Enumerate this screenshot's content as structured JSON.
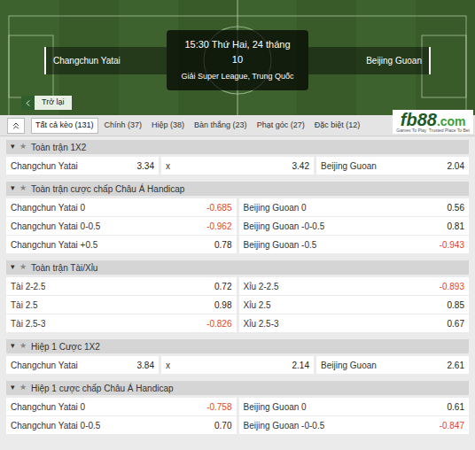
{
  "match": {
    "home": "Changchun Yatai",
    "away": "Beijing Guoan",
    "time": "15:30 Thứ Hai, 24 tháng 10",
    "league": "Giải Super League, Trung Quốc"
  },
  "back_button": {
    "label": "Trở lại"
  },
  "tabs": [
    {
      "label": "Tất cả kèo (131)",
      "selected": true
    },
    {
      "label": "Chính (37)",
      "selected": false
    },
    {
      "label": "Hiệp (38)",
      "selected": false
    },
    {
      "label": "Bàn thắng (23)",
      "selected": false
    },
    {
      "label": "Phạt góc (27)",
      "selected": false
    },
    {
      "label": "Đặc biệt (12)",
      "selected": false
    }
  ],
  "logo": {
    "name": "fb88",
    "suffix": ".com",
    "tagline": "Games To Play  Trusted Place To Bet"
  },
  "section_icons": {
    "toggle": "▾",
    "star": "★"
  },
  "sections": [
    {
      "title": "Toàn trận 1X2",
      "expanded": true,
      "rows": [
        {
          "cells": [
            {
              "label": "Changchun Yatai",
              "odds": "3.34",
              "negative": false
            },
            {
              "label": "x",
              "odds": "3.42",
              "negative": false
            },
            {
              "label": "Beijing Guoan",
              "odds": "2.04",
              "negative": false
            }
          ]
        }
      ]
    },
    {
      "title": "Toàn trận cược chấp Châu Á Handicap",
      "expanded": true,
      "rows": [
        {
          "cells": [
            {
              "label": "Changchun Yatai 0",
              "odds": "-0.685",
              "negative": true
            },
            {
              "label": "Beijing Guoan 0",
              "odds": "0.56",
              "negative": false
            }
          ]
        },
        {
          "cells": [
            {
              "label": "Changchun Yatai 0-0.5",
              "odds": "-0.962",
              "negative": true
            },
            {
              "label": "Beijing Guoan -0-0.5",
              "odds": "0.81",
              "negative": false
            }
          ]
        },
        {
          "cells": [
            {
              "label": "Changchun Yatai +0.5",
              "odds": "0.78",
              "negative": false
            },
            {
              "label": "Beijing Guoan -0.5",
              "odds": "-0.943",
              "negative": true
            }
          ]
        }
      ]
    },
    {
      "title": "Toàn trận Tài/Xỉu",
      "expanded": true,
      "rows": [
        {
          "cells": [
            {
              "label": "Tài 2-2.5",
              "odds": "0.72",
              "negative": false
            },
            {
              "label": "Xỉu 2-2.5",
              "odds": "-0.893",
              "negative": true
            }
          ]
        },
        {
          "cells": [
            {
              "label": "Tài 2.5",
              "odds": "0.98",
              "negative": false
            },
            {
              "label": "Xỉu 2.5",
              "odds": "0.85",
              "negative": false
            }
          ]
        },
        {
          "cells": [
            {
              "label": "Tài 2.5-3",
              "odds": "-0.826",
              "negative": true
            },
            {
              "label": "Xỉu 2.5-3",
              "odds": "0.67",
              "negative": false
            }
          ]
        }
      ]
    },
    {
      "title": "Hiệp 1 Cược 1X2",
      "expanded": true,
      "rows": [
        {
          "cells": [
            {
              "label": "Changchun Yatai",
              "odds": "3.84",
              "negative": false
            },
            {
              "label": "x",
              "odds": "2.14",
              "negative": false
            },
            {
              "label": "Beijing Guoan",
              "odds": "2.61",
              "negative": false
            }
          ]
        }
      ]
    },
    {
      "title": "Hiệp 1 cược chấp Châu Á Handicap",
      "expanded": true,
      "rows": [
        {
          "cells": [
            {
              "label": "Changchun Yatai 0",
              "odds": "-0.758",
              "negative": true
            },
            {
              "label": "Beijing Guoan 0",
              "odds": "0.61",
              "negative": false
            }
          ]
        },
        {
          "cells": [
            {
              "label": "Changchun Yatai 0-0.5",
              "odds": "0.70",
              "negative": false
            },
            {
              "label": "Beijing Guoan -0-0.5",
              "odds": "-0.847",
              "negative": true
            }
          ]
        }
      ]
    }
  ]
}
